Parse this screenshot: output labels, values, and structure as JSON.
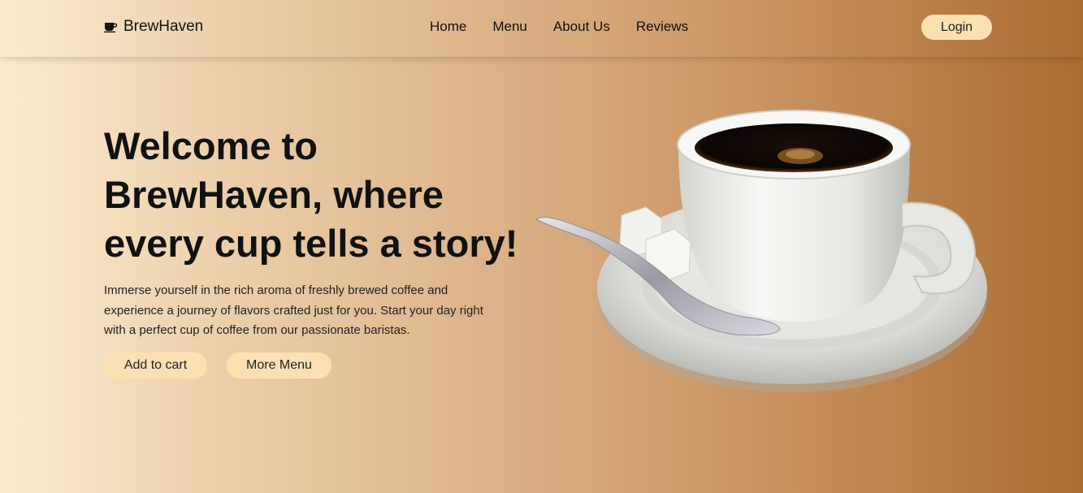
{
  "brand": {
    "name": "BrewHaven",
    "icon": "coffee-cup-icon"
  },
  "nav": {
    "links": [
      "Home",
      "Menu",
      "About Us",
      "Reviews"
    ],
    "login_label": "Login"
  },
  "hero": {
    "title": "Welcome to BrewHaven, where every cup tells a story!",
    "description": "Immerse yourself in the rich aroma of freshly brewed coffee and experience a journey of flavors crafted just for you. Start your day right with a perfect cup of coffee from our passionate baristas.",
    "add_to_cart_label": "Add to cart",
    "more_menu_label": "More Menu",
    "image": "coffee-cup-with-saucer-spoon-sugar-image"
  },
  "colors": {
    "button_bg": "#fde0b2",
    "gradient_start": "#fdebd0",
    "gradient_end": "#aa6d31",
    "text": "#111111"
  }
}
